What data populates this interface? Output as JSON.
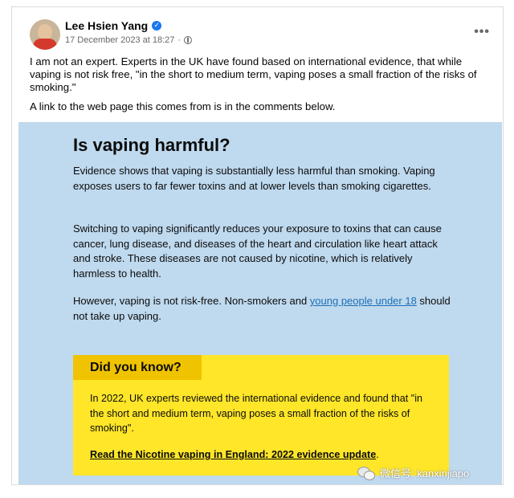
{
  "post": {
    "author": "Lee Hsien Yang",
    "timestamp": "17 December 2023 at 18:27",
    "separator": "·",
    "more_label": "•••",
    "text1": "I am not an expert.  Experts in the UK have found based on international evidence, that while vaping is not risk free,  \"in the short to medium term, vaping poses a small fraction of the risks of smoking.\"",
    "text2": "A link to the web page this comes from is in the comments below."
  },
  "card": {
    "heading": "Is vaping harmful?",
    "para1": "Evidence shows that vaping is substantially less harmful than smoking. Vaping exposes users to far fewer toxins and at lower levels than smoking cigarettes.",
    "para2": "Switching to vaping significantly reduces your exposure to toxins that can cause cancer, lung disease, and diseases of the heart and circulation like heart attack and stroke. These diseases are not caused by nicotine, which is relatively harmless to health.",
    "para3_before": "However, vaping is not risk-free. Non-smokers and ",
    "para3_link": "young people under 18",
    "para3_after": " should not take up vaping.",
    "did_label": "Did you know?",
    "did_text": "In 2022, UK experts reviewed the international evidence and found that \"in the short and medium term, vaping poses a small fraction of the risks of smoking\".",
    "did_link": "Read the Nicotine vaping in England: 2022 evidence update",
    "did_link_suffix": "."
  },
  "watermark": {
    "text": "微信号: kanxinjiapo"
  },
  "colors": {
    "card_bg": "#bfd9ee",
    "callout_bg": "#ffe628",
    "callout_label_bg": "#f0c300",
    "link": "#1d70b8",
    "verified": "#1877f2"
  },
  "icons": {
    "verified": "verified-badge-icon",
    "audience": "globe-icon",
    "more": "more-options-icon",
    "watermark": "wechat-icon"
  }
}
